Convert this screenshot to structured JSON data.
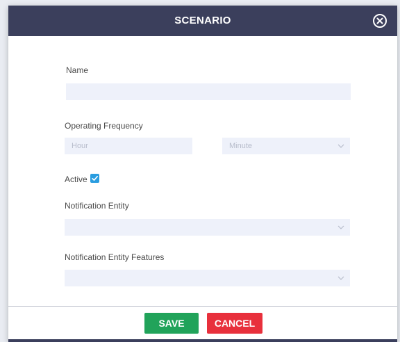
{
  "modal": {
    "title": "SCENARIO"
  },
  "form": {
    "name": {
      "label": "Name",
      "value": "",
      "placeholder": ""
    },
    "operating_frequency": {
      "label": "Operating Frequency",
      "hour": {
        "value": "",
        "placeholder": "Hour"
      },
      "minute": {
        "selected": "Minute"
      }
    },
    "active": {
      "label": "Active",
      "checked": true
    },
    "notification_entity": {
      "label": "Notification Entity",
      "selected": ""
    },
    "notification_entity_features": {
      "label": "Notification Entity Features",
      "selected": ""
    }
  },
  "footer": {
    "save_label": "SAVE",
    "cancel_label": "CANCEL"
  },
  "colors": {
    "header": "#3b3f5c",
    "field_bg": "#eef1fa",
    "save": "#21a35a",
    "cancel": "#e8303c",
    "checkbox": "#2a9de0"
  },
  "icons": {
    "close": "close-circle-icon",
    "dropdown": "chevron-down-icon",
    "check": "checkmark-icon"
  }
}
